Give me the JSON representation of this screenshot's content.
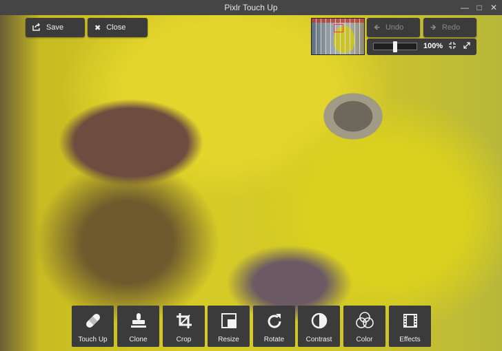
{
  "window": {
    "title": "Pixlr Touch Up"
  },
  "actions": {
    "save": "Save",
    "close": "Close",
    "undo": "Undo",
    "redo": "Redo"
  },
  "zoom": {
    "level": "100%",
    "slider_fraction": 0.5
  },
  "tools": [
    {
      "label": "Touch Up",
      "icon": "bandage-icon"
    },
    {
      "label": "Clone",
      "icon": "stamp-icon"
    },
    {
      "label": "Crop",
      "icon": "crop-icon"
    },
    {
      "label": "Resize",
      "icon": "resize-icon"
    },
    {
      "label": "Rotate",
      "icon": "rotate-icon"
    },
    {
      "label": "Contrast",
      "icon": "contrast-icon"
    },
    {
      "label": "Color",
      "icon": "color-circles-icon"
    },
    {
      "label": "Effects",
      "icon": "film-strip-icon"
    }
  ]
}
